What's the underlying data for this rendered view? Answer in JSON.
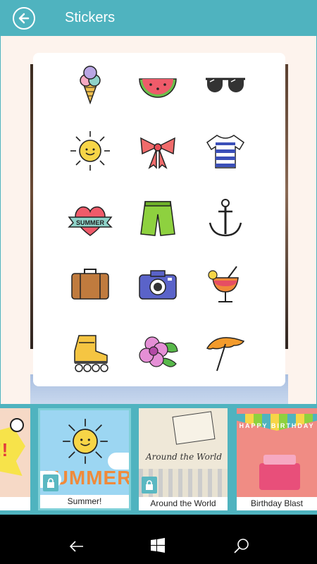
{
  "header": {
    "title": "Stickers"
  },
  "stickers": {
    "rows": [
      [
        "ice-cream",
        "watermelon",
        "sunglasses"
      ],
      [
        "sun",
        "bow",
        "striped-shirt"
      ],
      [
        "summer-heart",
        "shorts",
        "anchor"
      ],
      [
        "suitcase",
        "camera",
        "cocktail"
      ],
      [
        "roller-skate",
        "flower",
        "beach-umbrella"
      ]
    ],
    "heart_banner_text": "SUMMER"
  },
  "packs": [
    {
      "label": "",
      "art_text": "!!"
    },
    {
      "label": "Summer!",
      "art_text": "SUMMER",
      "selected": true
    },
    {
      "label": "Around the World",
      "art_text": "Around the World"
    },
    {
      "label": "Birthday Blast",
      "art_text": "HAPPY BIRTHDAY"
    }
  ],
  "navbar": {
    "icons": [
      "back-arrow-icon",
      "windows-start-icon",
      "search-icon"
    ]
  },
  "colors": {
    "accent": "#4fb3bf",
    "canvas": "#fdf3ed"
  }
}
